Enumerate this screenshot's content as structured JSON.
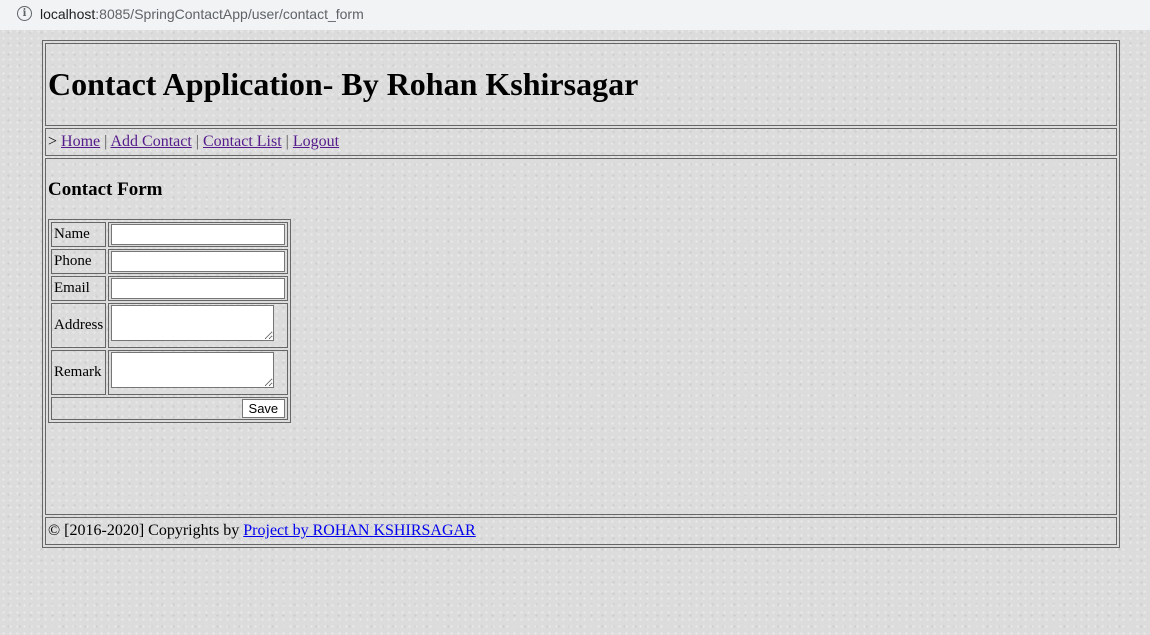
{
  "browser": {
    "url_host": "localhost",
    "url_path": ":8085/SpringContactApp/user/contact_form"
  },
  "header": {
    "title": "Contact Application- By Rohan Kshirsagar"
  },
  "menu": {
    "prefix": ">",
    "items": [
      "Home",
      "Add Contact",
      "Contact List",
      "Logout"
    ],
    "separator": "|"
  },
  "content": {
    "heading": "Contact Form",
    "fields": [
      {
        "label": "Name",
        "value": ""
      },
      {
        "label": "Phone",
        "value": ""
      },
      {
        "label": "Email",
        "value": ""
      },
      {
        "label": "Address",
        "value": ""
      },
      {
        "label": "Remark",
        "value": ""
      }
    ],
    "save_label": "Save"
  },
  "footer": {
    "copyright": "© [2016-2020] Copyrights by",
    "link_text": "Project by ROHAN KSHIRSAGAR"
  },
  "colors": {
    "visited_link": "#551a8b",
    "link": "#0000ee",
    "background": "#dcdcdc"
  }
}
